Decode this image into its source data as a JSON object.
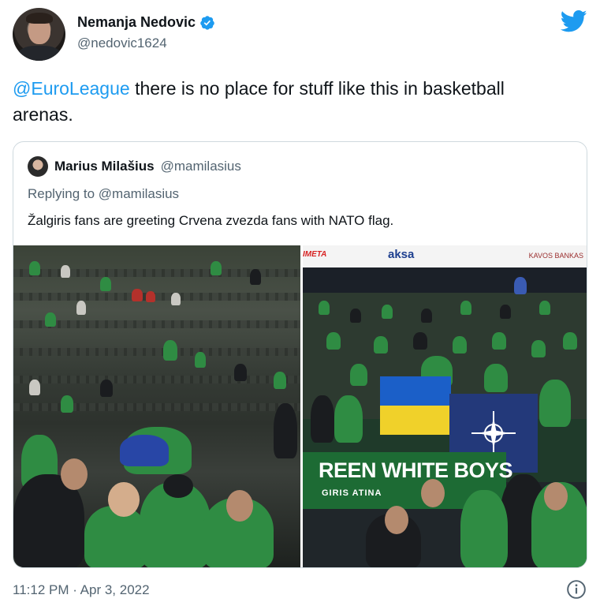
{
  "author": {
    "display_name": "Nemanja Nedovic",
    "handle": "@nedovic1624",
    "verified_icon": "verified-badge-icon"
  },
  "brand": {
    "logo": "twitter-bird-icon",
    "color": "#1d9bf0"
  },
  "tweet": {
    "mention": "@EuroLeague",
    "text": " there is no place for stuff like this in basketball arenas."
  },
  "quoted_tweet": {
    "display_name": "Marius Milašius",
    "handle": "@mamilasius",
    "replying_prefix": "Replying to ",
    "replying_to": "@mamilasius",
    "text": "Žalgiris fans are greeting Crvena zvezda fans with NATO flag.",
    "photo_right": {
      "sponsor_left": "IMETA",
      "sponsor_center": "aksa",
      "sponsor_right": "KAVOS BANKAS",
      "banner_text": "REEN WHITE BOYS",
      "banner_sub": "GIRIS    ATINA"
    }
  },
  "timestamp": "11:12 PM · Apr 3, 2022",
  "colors": {
    "text_primary": "#0f1419",
    "text_secondary": "#536471",
    "border": "#cfd9de",
    "accent": "#1d9bf0"
  }
}
